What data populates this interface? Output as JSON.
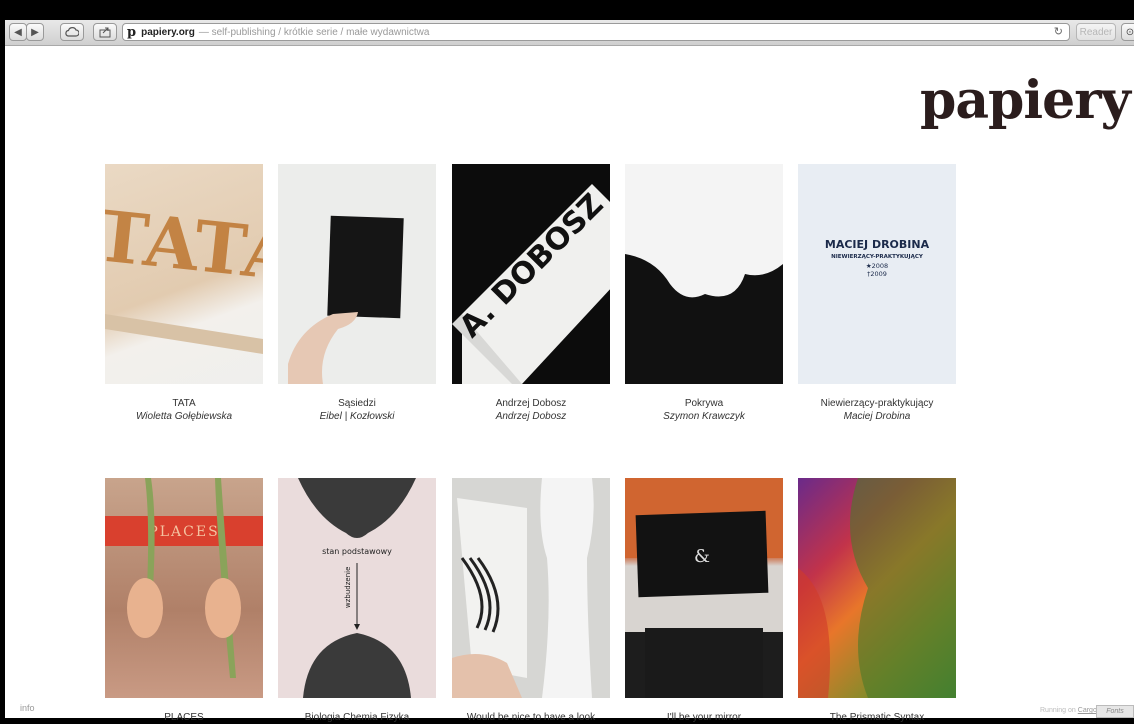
{
  "browser": {
    "url_domain": "papiery.org",
    "url_rest": "— self-publishing / krótkie serie / małe wydawnictwa",
    "favicon_letter": "p",
    "reader_label": "Reader"
  },
  "site": {
    "logo": "papiery"
  },
  "books_row1": [
    {
      "title": "TATA",
      "author": "Wioletta Gołębiewska"
    },
    {
      "title": "Sąsiedzi",
      "author": "Eibel | Kozłowski"
    },
    {
      "title": "Andrzej Dobosz",
      "author": "Andrzej Dobosz"
    },
    {
      "title": "Pokrywa",
      "author": "Szymon Krawczyk"
    },
    {
      "title": "Niewierzący-praktykujący",
      "author": "Maciej Drobina"
    }
  ],
  "books_row2": [
    {
      "title": "PLACES"
    },
    {
      "title": "Biologia Chemia Fizyka"
    },
    {
      "title": "Would be nice to have a look"
    },
    {
      "title": "I'll be your mirror"
    },
    {
      "title": "The Prismatic Syntax"
    }
  ],
  "cover_text": {
    "tata": "TATA",
    "dobosz": "A. DOBOSZ",
    "drobina_name": "MACIEJ DROBINA",
    "drobina_sub": "NIEWIERZĄCY-PRAKTYKUJĄCY",
    "drobina_born": "★2008",
    "drobina_died": "†2009",
    "places": "PLACES",
    "biologia_top": "stan podstawowy",
    "biologia_side": "wzbudzenie"
  },
  "footer": {
    "info": "info",
    "running_on": "Running on",
    "cargo": "Cargo",
    "fonts": "Fonts"
  },
  "colors": {
    "logo": "#2b1d1d",
    "caption": "#333333"
  }
}
